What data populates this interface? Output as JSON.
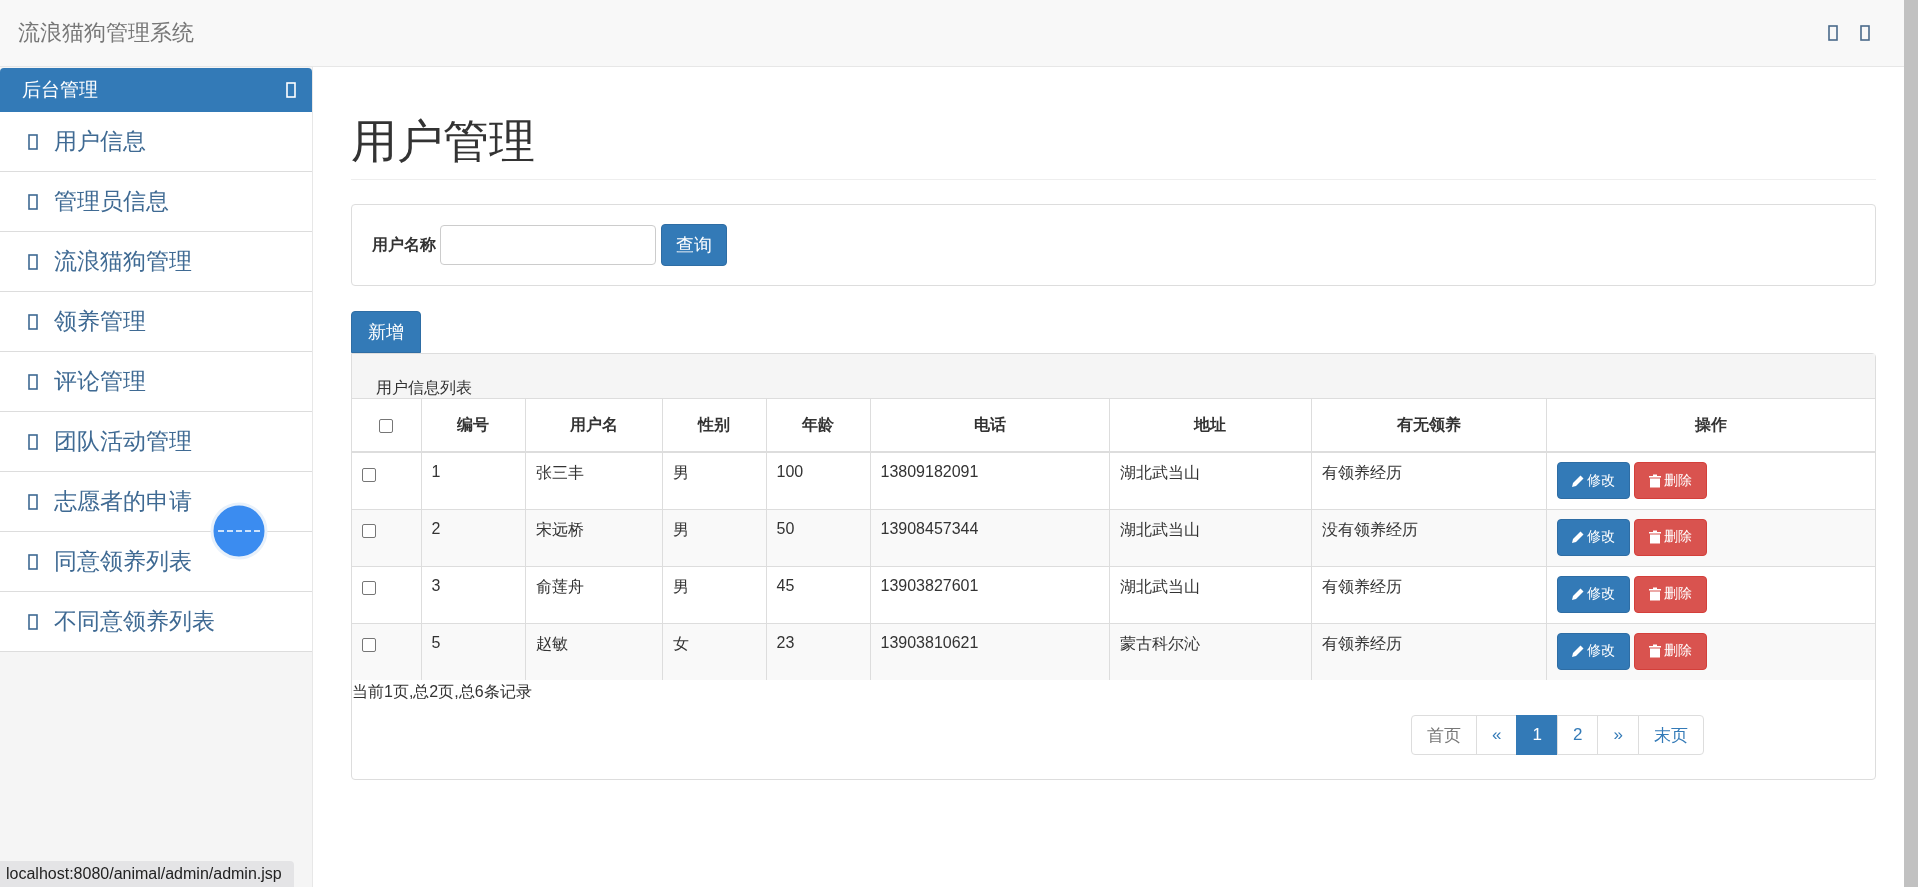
{
  "navbar": {
    "brand": "流浪猫狗管理系统"
  },
  "sidebar": {
    "header": "后台管理",
    "items": [
      {
        "label": "用户信息"
      },
      {
        "label": "管理员信息"
      },
      {
        "label": "流浪猫狗管理"
      },
      {
        "label": "领养管理"
      },
      {
        "label": "评论管理"
      },
      {
        "label": "团队活动管理"
      },
      {
        "label": "志愿者的申请"
      },
      {
        "label": "同意领养列表"
      },
      {
        "label": "不同意领养列表"
      }
    ]
  },
  "page_title": "用户管理",
  "search": {
    "label": "用户名称",
    "button": "查询"
  },
  "add_button": "新增",
  "table": {
    "caption": "用户信息列表",
    "select_all": {
      "checked": false
    },
    "columns": [
      "编号",
      "用户名",
      "性别",
      "年龄",
      "电话",
      "地址",
      "有无领养",
      "操作"
    ],
    "rows": [
      {
        "checked": false,
        "cells": [
          "1",
          "张三丰",
          "男",
          "100",
          "13809182091",
          "湖北武当山",
          "有领养经历"
        ],
        "edit": "修改",
        "delete": "删除"
      },
      {
        "checked": false,
        "cells": [
          "2",
          "宋远桥",
          "男",
          "50",
          "13908457344",
          "湖北武当山",
          "没有领养经历"
        ],
        "edit": "修改",
        "delete": "删除"
      },
      {
        "checked": false,
        "cells": [
          "3",
          "俞莲舟",
          "男",
          "45",
          "13903827601",
          "湖北武当山",
          "有领养经历"
        ],
        "edit": "修改",
        "delete": "删除"
      },
      {
        "checked": false,
        "cells": [
          "5",
          "赵敏",
          "女",
          "23",
          "13903810621",
          "蒙古科尔沁",
          "有领养经历"
        ],
        "edit": "修改",
        "delete": "删除"
      }
    ],
    "summary": "当前1页,总2页,总6条记录",
    "pagination": [
      {
        "label": "首页",
        "selected": false,
        "disabled": true
      },
      {
        "label": "«",
        "selected": false,
        "disabled": false
      },
      {
        "label": "1",
        "selected": true,
        "disabled": false
      },
      {
        "label": "2",
        "selected": false,
        "disabled": false
      },
      {
        "label": "»",
        "selected": false,
        "disabled": false
      },
      {
        "label": "末页",
        "selected": false,
        "disabled": false
      }
    ]
  },
  "status_url": "localhost:8080/animal/admin/admin.jsp"
}
